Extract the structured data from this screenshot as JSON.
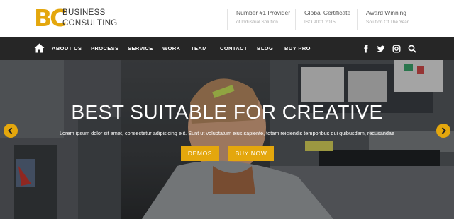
{
  "brand": {
    "mark": "BC",
    "line1": "BUSINESS",
    "line2": "CONSULTING",
    "accent": "#e4a70d"
  },
  "info": [
    {
      "heading": "Number #1 Provider",
      "sub": "of Industrial Solution"
    },
    {
      "heading": "Global Certificate",
      "sub": "ISO 9001 2015"
    },
    {
      "heading": "Award Winning",
      "sub": "Solution Of The Year"
    }
  ],
  "nav": {
    "home_icon": "home-icon",
    "items": [
      "ABOUT US",
      "PROCESS",
      "SERVICE",
      "WORK",
      "TEAM",
      "CONTACT",
      "BLOG",
      "BUY PRO"
    ],
    "social": [
      "facebook-icon",
      "twitter-icon",
      "instagram-icon",
      "search-icon"
    ]
  },
  "hero": {
    "title": "BEST SUITABLE FOR CREATIVE",
    "subtitle": "Lorem ipsum dolor sit amet, consectetur adipisicing elit. Sunt ut voluptatum eius sapiente, totam reiciendis temporibus qui quibusdam, recusandae",
    "primary_button": "DEMOS",
    "secondary_button": "BUY NOW",
    "prev_icon": "chevron-left-icon",
    "next_icon": "chevron-right-icon"
  }
}
